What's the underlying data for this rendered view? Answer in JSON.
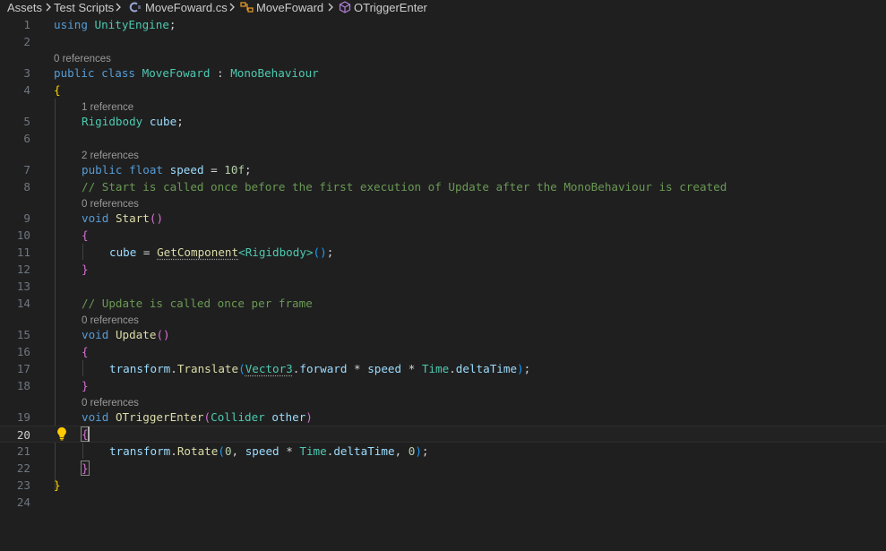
{
  "breadcrumb": {
    "items": [
      "Assets",
      "Test Scripts",
      "MoveFoward.cs",
      "MoveFoward",
      "OTriggerEnter"
    ]
  },
  "editor": {
    "line_numbers": [
      "1",
      "2",
      "3",
      "4",
      "5",
      "6",
      "7",
      "8",
      "9",
      "10",
      "11",
      "12",
      "13",
      "14",
      "15",
      "16",
      "17",
      "18",
      "19",
      "20",
      "21",
      "22",
      "23",
      "24"
    ],
    "active_line": "20",
    "codelens": {
      "class": "0 references",
      "cube": "1 reference",
      "speed": "2 references",
      "start": "0 references",
      "update": "0 references",
      "trigger": "0 references"
    },
    "code": {
      "l1_using": "using",
      "l1_ns": "UnityEngine",
      "l3_public": "public",
      "l3_class": "class",
      "l3_name": "MoveFoward",
      "l3_colon": " : ",
      "l3_base": "MonoBehaviour",
      "l5_type": "Rigidbody",
      "l5_name": "cube",
      "l7_public": "public",
      "l7_float": "float",
      "l7_name": "speed",
      "l7_num": "10f",
      "l8_comment": "// Start is called once before the first execution of Update after the MonoBehaviour is created",
      "l9_void": "void",
      "l9_name": "Start",
      "l11_var": "cube",
      "l11_method": "GetComponent",
      "l11_generic": "Rigidbody",
      "l14_comment": "// Update is called once per frame",
      "l15_void": "void",
      "l15_name": "Update",
      "l17_obj": "transform",
      "l17_method": "Translate",
      "l17_type": "Vector3",
      "l17_prop": "forward",
      "l17_speed": "speed",
      "l17_time": "Time",
      "l17_dt": "deltaTime",
      "l19_void": "void",
      "l19_name": "OTriggerEnter",
      "l19_ptype": "Collider",
      "l19_pname": "other",
      "l21_obj": "transform",
      "l21_method": "Rotate",
      "l21_zero1": "0",
      "l21_speed": "speed",
      "l21_time": "Time",
      "l21_dt": "deltaTime",
      "l21_zero2": "0"
    }
  },
  "colors": {
    "background": "#1f1f1f",
    "keyword": "#569cd6",
    "type": "#4ec9b0",
    "method": "#dcdcaa",
    "variable": "#9cdcfe",
    "number": "#b5cea8",
    "comment": "#6a9955",
    "bracket_level1": "#ffd700",
    "bracket_level2": "#da70d6",
    "bracket_level3": "#179fff"
  },
  "icons": {
    "breadcrumb_separator": "chevron-right-icon",
    "file_icon": "csharp-file-icon",
    "class_icon": "class-symbol-icon",
    "method_icon": "method-cube-icon",
    "lightbulb": "lightbulb-icon"
  }
}
